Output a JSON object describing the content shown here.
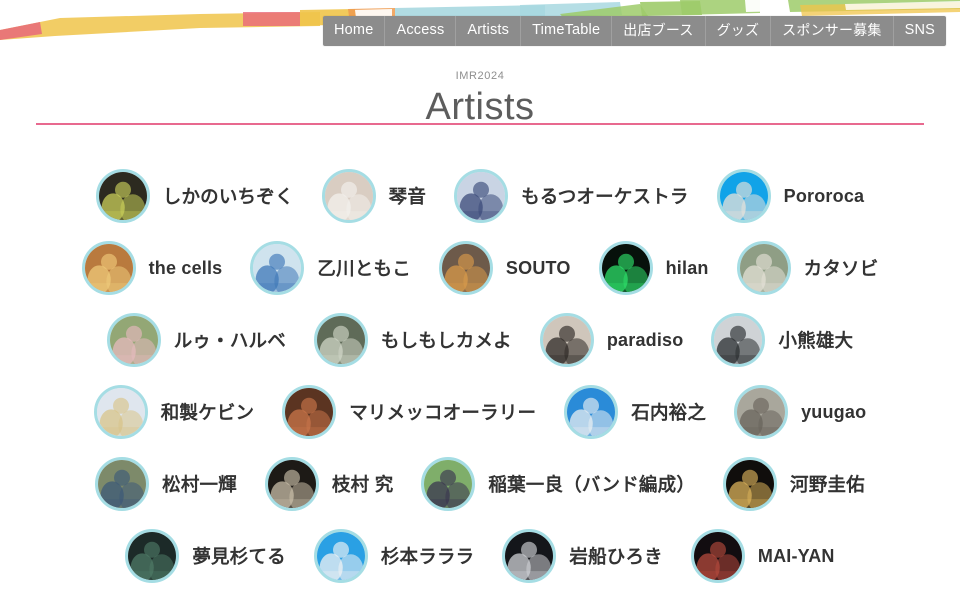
{
  "nav": {
    "items": [
      {
        "label": "Home",
        "jp": false
      },
      {
        "label": "Access",
        "jp": false
      },
      {
        "label": "Artists",
        "jp": false
      },
      {
        "label": "TimeTable",
        "jp": false
      },
      {
        "label": "出店ブース",
        "jp": true
      },
      {
        "label": "グッズ",
        "jp": true
      },
      {
        "label": "スポンサー募集",
        "jp": true
      },
      {
        "label": "SNS",
        "jp": false
      }
    ]
  },
  "header": {
    "eyebrow": "IMR2024",
    "title": "Artists"
  },
  "colors": {
    "nav_background": "#8c8c8c",
    "divider": "#e8698f",
    "avatar_ring": "#a5dde4",
    "title_text": "#5d5d5d",
    "artist_text": "#333333"
  },
  "artists": {
    "rows": [
      [
        {
          "name": "しかのいちぞく",
          "jp": true,
          "avatar": "portrait-band-foliage",
          "bg": "#2c2a20",
          "accent": "#c9cf5a"
        },
        {
          "name": "琴音",
          "jp": true,
          "avatar": "portrait-woman-white",
          "bg": "#d9cdc2",
          "accent": "#f3f0ec"
        },
        {
          "name": "もるつオーケストラ",
          "jp": true,
          "avatar": "portrait-group-uniform",
          "bg": "#c9d4e4",
          "accent": "#3b4b7a"
        },
        {
          "name": "Pororoca",
          "jp": false,
          "avatar": "portrait-group-blue",
          "bg": "#11a3e8",
          "accent": "#e8e2da"
        }
      ],
      [
        {
          "name": "the cells",
          "jp": false,
          "avatar": "portrait-band-warm",
          "bg": "#b97a3e",
          "accent": "#efca7a"
        },
        {
          "name": "乙川ともこ",
          "jp": true,
          "avatar": "portrait-woman-blue",
          "bg": "#cfe3ee",
          "accent": "#3f78b8"
        },
        {
          "name": "SOUTO",
          "jp": false,
          "avatar": "portrait-guitarist-hat",
          "bg": "#6d5a4a",
          "accent": "#d89a4a"
        },
        {
          "name": "hilan",
          "jp": false,
          "avatar": "portrait-neon-dark",
          "bg": "#07110b",
          "accent": "#2ee06a"
        },
        {
          "name": "カタソビ",
          "jp": true,
          "avatar": "portrait-duo-outdoor",
          "bg": "#8f9e85",
          "accent": "#e3e0d6"
        }
      ],
      [
        {
          "name": "ルゥ・ハルベ",
          "jp": true,
          "avatar": "portrait-woman-garden",
          "bg": "#93a775",
          "accent": "#e6b9bd"
        },
        {
          "name": "もしもしカメよ",
          "jp": true,
          "avatar": "portrait-group-outdoor",
          "bg": "#5f6b58",
          "accent": "#cfd6c6"
        },
        {
          "name": "paradiso",
          "jp": false,
          "avatar": "portrait-group-studio",
          "bg": "#cfc6bb",
          "accent": "#2f2a27"
        },
        {
          "name": "小熊雄大",
          "jp": true,
          "avatar": "portrait-man-bw",
          "bg": "#cfd3d6",
          "accent": "#2a2d30"
        }
      ],
      [
        {
          "name": "和製ケビン",
          "jp": true,
          "avatar": "portrait-man-beige",
          "bg": "#dfe6ee",
          "accent": "#d8c48a"
        },
        {
          "name": "マリメッコオーラリー",
          "jp": true,
          "avatar": "portrait-duo-warm",
          "bg": "#5b3421",
          "accent": "#c9754a"
        },
        {
          "name": "石内裕之",
          "jp": true,
          "avatar": "portrait-man-blue-sky",
          "bg": "#2a8bd8",
          "accent": "#e8eef2"
        },
        {
          "name": "yuugao",
          "jp": false,
          "avatar": "portrait-duo-street",
          "bg": "#a9a79c",
          "accent": "#6a645c"
        }
      ],
      [
        {
          "name": "松村一輝",
          "jp": true,
          "avatar": "portrait-man-seated",
          "bg": "#7d8a6a",
          "accent": "#3e5a78"
        },
        {
          "name": "枝村 究",
          "jp": true,
          "avatar": "portrait-man-dark",
          "bg": "#1d1a16",
          "accent": "#c8bda8"
        },
        {
          "name": "稲葉一良（バンド編成）",
          "jp": true,
          "avatar": "portrait-guitarist-outdoor",
          "bg": "#7fae6a",
          "accent": "#3a3550"
        },
        {
          "name": "河野圭佑",
          "jp": true,
          "avatar": "portrait-man-lights",
          "bg": "#100e0c",
          "accent": "#d9b15a"
        }
      ],
      [
        {
          "name": "夢見杉てる",
          "jp": true,
          "avatar": "portrait-green-dark",
          "bg": "#1c2a28",
          "accent": "#4e7a66"
        },
        {
          "name": "杉本ラララ",
          "jp": true,
          "avatar": "portrait-man-bluesky",
          "bg": "#2aa0e4",
          "accent": "#f0f2f4"
        },
        {
          "name": "岩船ひろき",
          "jp": true,
          "avatar": "portrait-man-stage",
          "bg": "#14161a",
          "accent": "#cfd2d6"
        },
        {
          "name": "MAI-YAN",
          "jp": false,
          "avatar": "portrait-woman-stage",
          "bg": "#120d10",
          "accent": "#b4493c"
        }
      ]
    ]
  }
}
